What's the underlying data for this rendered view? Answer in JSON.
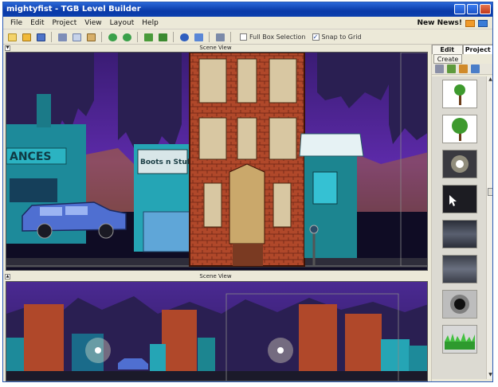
{
  "window": {
    "title": "mightyfist - TGB Level Builder"
  },
  "menu": {
    "items": [
      "File",
      "Edit",
      "Project",
      "View",
      "Layout",
      "Help"
    ],
    "news_label": "New News!"
  },
  "toolbar": {
    "full_box_selection_label": "Full Box Selection",
    "full_box_selection_checked": false,
    "snap_to_grid_label": "Snap to Grid",
    "snap_to_grid_checked": true
  },
  "views": {
    "top_label": "Scene View",
    "bottom_label": "Scene View"
  },
  "right_panel": {
    "tabs": [
      "Edit",
      "Project"
    ],
    "active_tab": "Project",
    "create_label": "Create",
    "thumbnails": [
      "tree-small",
      "tree-large",
      "glow-light",
      "cursor-preview",
      "fog-texture",
      "fog-texture-2",
      "dark-orb",
      "green-grass"
    ]
  },
  "scene": {
    "signs": [
      "ANCES",
      "Boots n Stuff"
    ]
  }
}
